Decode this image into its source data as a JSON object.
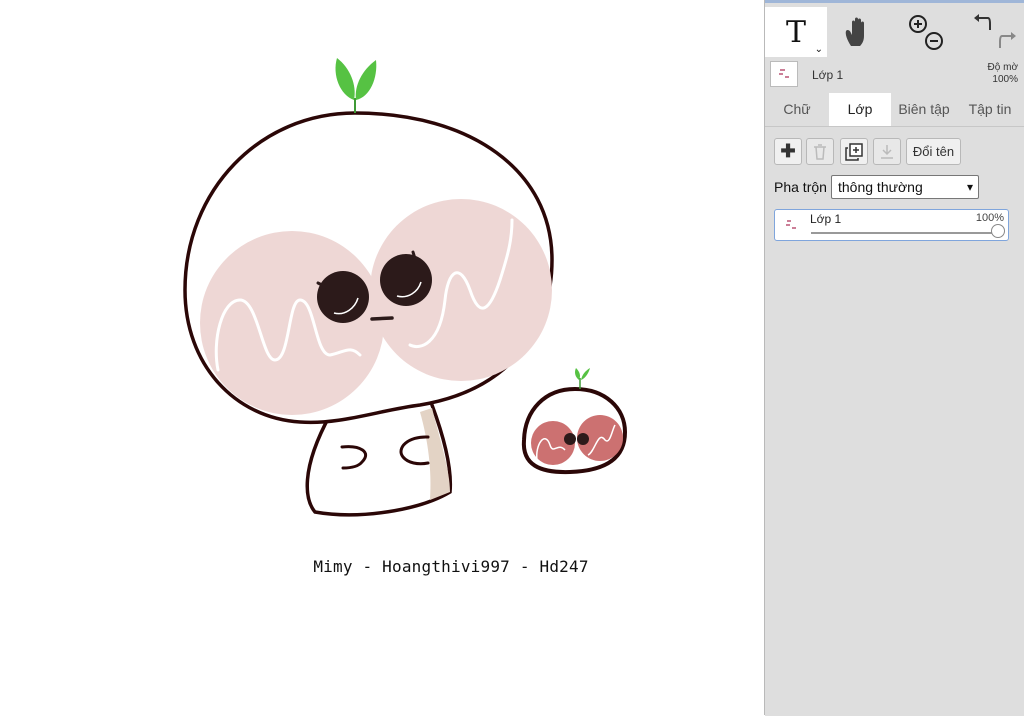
{
  "canvas": {
    "caption": "Mimy - Hoangthivi997 - Hd247",
    "colors": {
      "outline": "#2b0707",
      "blush": "#eed7d5",
      "leaf": "#56c243",
      "eye": "#2c1a1a"
    }
  },
  "toolbar": {
    "tools": [
      {
        "name": "text-tool",
        "label": "T",
        "icon": "text-icon"
      },
      {
        "name": "hand-tool",
        "icon": "hand-icon"
      },
      {
        "name": "zoom-tool",
        "icon": "zoom-in-out-icon"
      },
      {
        "name": "undo-redo",
        "icon": "undo-redo-icon"
      }
    ]
  },
  "layer_bar": {
    "name": "Lớp 1",
    "opacity_label": "Độ mờ",
    "opacity_value": "100%"
  },
  "tabs": [
    {
      "label": "Chữ",
      "active": false
    },
    {
      "label": "Lớp",
      "active": true
    },
    {
      "label": "Biên tập",
      "active": false
    },
    {
      "label": "Tập tin",
      "active": false
    }
  ],
  "layer_panel": {
    "rename_label": "Đổi tên",
    "blend_label": "Pha trộn",
    "blend_value": "thông thường",
    "layers": [
      {
        "name": "Lớp 1",
        "opacity": "100%"
      }
    ]
  }
}
